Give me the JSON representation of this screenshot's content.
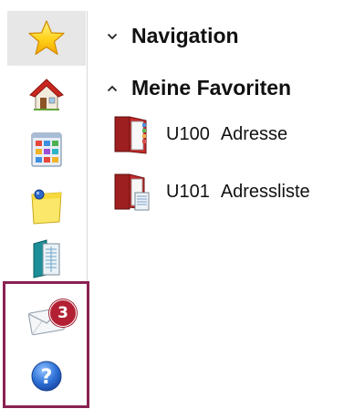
{
  "sidebar": {
    "items": [
      {
        "icon": "star-icon",
        "active": true
      },
      {
        "icon": "house-icon",
        "active": false
      },
      {
        "icon": "app-grid-icon",
        "active": false
      },
      {
        "icon": "sticky-note-icon",
        "active": false
      },
      {
        "icon": "document-icon",
        "active": false
      },
      {
        "icon": "mail-icon",
        "active": false
      },
      {
        "icon": "help-icon",
        "active": false
      }
    ],
    "mail_badge_count": "3",
    "highlight_color": "#8a2252",
    "badge_color": "#b32033"
  },
  "tree": {
    "navigation": {
      "label": "Navigation",
      "expanded": false
    },
    "favorites": {
      "label": "Meine Favoriten",
      "expanded": true,
      "items": [
        {
          "code": "U100",
          "name": "Adresse",
          "icon": "address-book-icon"
        },
        {
          "code": "U101",
          "name": "Adressliste",
          "icon": "address-list-icon"
        }
      ]
    }
  }
}
